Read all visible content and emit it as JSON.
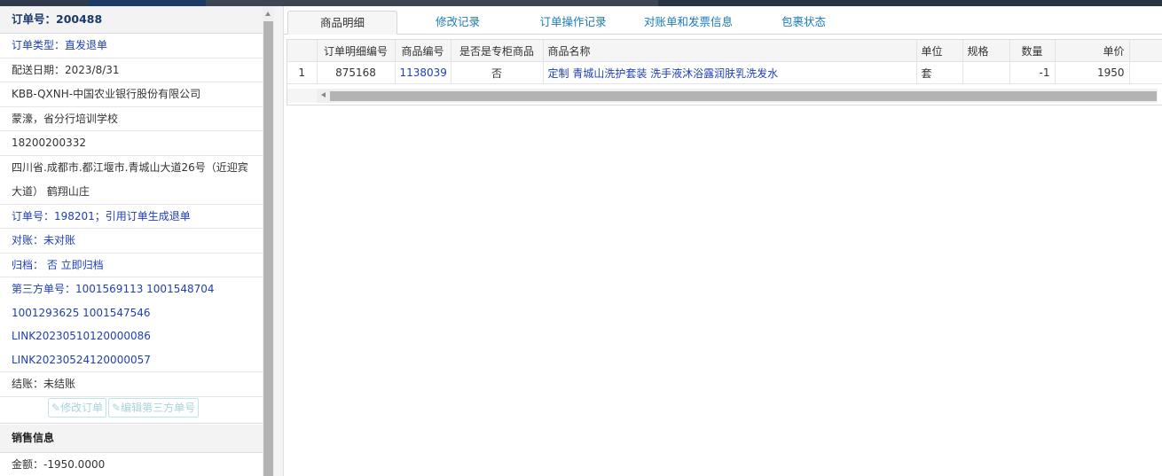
{
  "order_header": "订单号：200488",
  "left_rows": [
    {
      "text": "订单类型：直发退单",
      "style": "blue"
    },
    {
      "text": "配送日期：2023/8/31",
      "style": "dark"
    },
    {
      "text": "KBB-QXNH-中国农业银行股份有限公司",
      "style": "dark"
    },
    {
      "text": "蒙濠，省分行培训学校",
      "style": "dark"
    },
    {
      "text": "18200200332",
      "style": "dark"
    }
  ],
  "address": "四川省.成都市.都江堰市.青城山大道26号（近迎宾大道） 鹤翔山庄",
  "left_rows2": [
    {
      "text": "订单号：198201；引用订单生成退单",
      "style": "blue"
    },
    {
      "text": "对账：未对账",
      "style": "blue"
    },
    {
      "text": "归档： 否 立即归档",
      "style": "blue"
    },
    {
      "text": "第三方单号：1001569113 1001548704",
      "style": "blue"
    },
    {
      "text": "1001293625 1001547546",
      "style": "blue"
    },
    {
      "text": "LINK20230510120000086",
      "style": "blue"
    },
    {
      "text": "LINK20230524120000057",
      "style": "blue"
    },
    {
      "text": "结账：未结账",
      "style": "dark"
    }
  ],
  "buttons": {
    "edit_order": "修改订单",
    "edit_third_party": "编辑第三方单号"
  },
  "sales_section": {
    "title": "销售信息",
    "amount": "金额：-1950.0000"
  },
  "tabs": [
    {
      "label": "商品明细",
      "active": true
    },
    {
      "label": "修改记录",
      "active": false
    },
    {
      "label": "订单操作记录",
      "active": false
    },
    {
      "label": "对账单和发票信息",
      "active": false
    },
    {
      "label": "包裹状态",
      "active": false
    }
  ],
  "grid": {
    "headers": [
      "",
      "订单明细编号",
      "商品编号",
      "是否是专柜商品",
      "商品名称",
      "单位",
      "规格",
      "数量",
      "单价"
    ],
    "rows": [
      [
        "1",
        "875168",
        "1138039",
        "否",
        "定制 青城山洗护套装 洗手液沐浴露润肤乳洗发水",
        "套",
        "",
        "-1",
        "1950"
      ]
    ]
  }
}
